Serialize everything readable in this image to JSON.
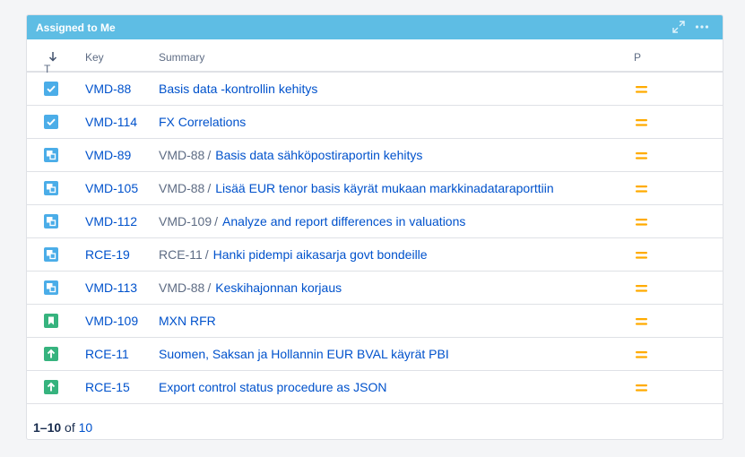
{
  "gadget": {
    "title": "Assigned to Me"
  },
  "header_icons": [
    "expand-icon",
    "more-icon"
  ],
  "columns": {
    "t": "T",
    "key": "Key",
    "summary": "Summary",
    "p": "P"
  },
  "rows": [
    {
      "type": "task",
      "key": "VMD-88",
      "parent": "",
      "summary": "Basis data -kontrollin kehitys",
      "priority": "medium"
    },
    {
      "type": "task",
      "key": "VMD-114",
      "parent": "",
      "summary": "FX Correlations",
      "priority": "medium"
    },
    {
      "type": "subtask",
      "key": "VMD-89",
      "parent": "VMD-88",
      "summary": "Basis data sähköpostiraportin kehitys",
      "priority": "medium"
    },
    {
      "type": "subtask",
      "key": "VMD-105",
      "parent": "VMD-88",
      "summary": "Lisää EUR tenor basis käyrät mukaan markkinadataraporttiin",
      "priority": "medium"
    },
    {
      "type": "subtask",
      "key": "VMD-112",
      "parent": "VMD-109",
      "summary": "Analyze and report differences in valuations",
      "priority": "medium"
    },
    {
      "type": "subtask",
      "key": "RCE-19",
      "parent": "RCE-11",
      "summary": "Hanki pidempi aikasarja govt bondeille",
      "priority": "medium"
    },
    {
      "type": "subtask",
      "key": "VMD-113",
      "parent": "VMD-88",
      "summary": "Keskihajonnan korjaus",
      "priority": "medium"
    },
    {
      "type": "story",
      "key": "VMD-109",
      "parent": "",
      "summary": "MXN RFR",
      "priority": "medium"
    },
    {
      "type": "improvement",
      "key": "RCE-11",
      "parent": "",
      "summary": "Suomen, Saksan ja Hollannin EUR BVAL käyrät PBI",
      "priority": "medium"
    },
    {
      "type": "improvement",
      "key": "RCE-15",
      "parent": "",
      "summary": "Export control status procedure as JSON",
      "priority": "medium"
    }
  ],
  "pagination": {
    "range": "1–10",
    "of": "of",
    "total": "10"
  },
  "colors": {
    "header": "#5ebde4",
    "task": "#4bade8",
    "subtask": "#4bade8",
    "story": "#36b37e",
    "improvement": "#36b37e",
    "priority_medium": "#ffab00",
    "link": "#0052cc"
  }
}
